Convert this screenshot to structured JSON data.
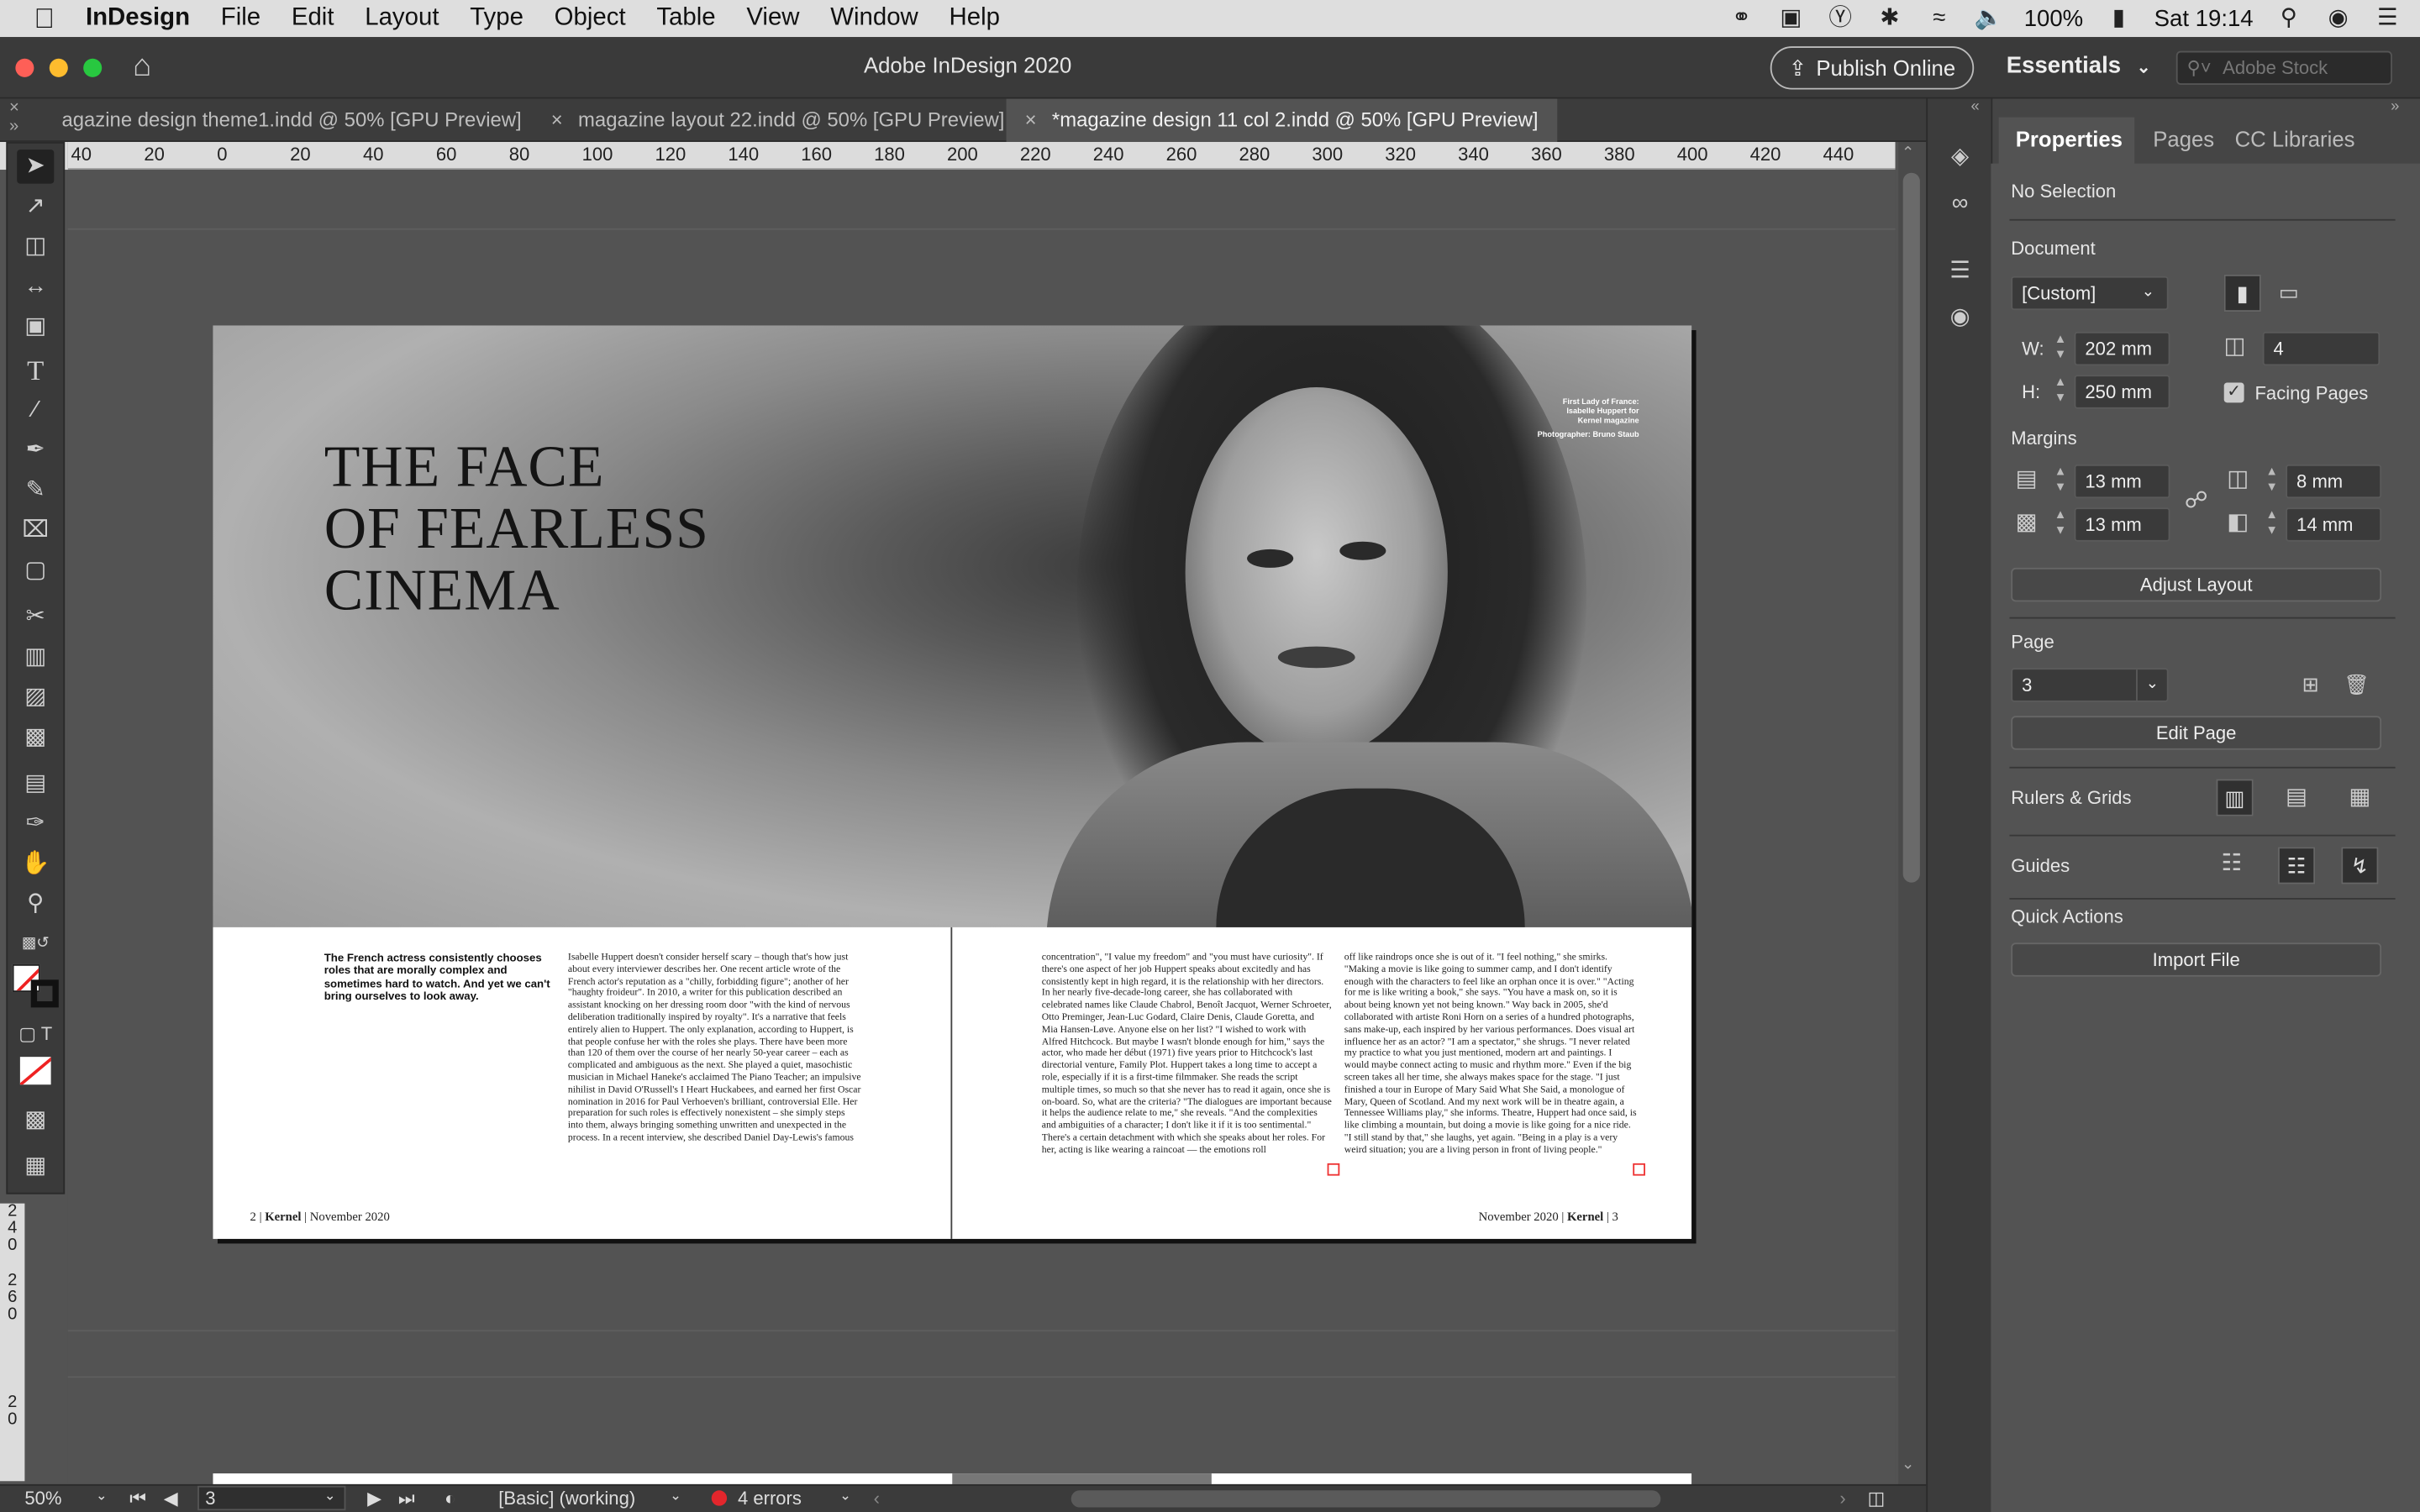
{
  "menubar": {
    "app": "InDesign",
    "items": [
      "File",
      "Edit",
      "Layout",
      "Type",
      "Object",
      "Table",
      "View",
      "Window",
      "Help"
    ],
    "battery": "100%",
    "clock": "Sat 19:14"
  },
  "window": {
    "title": "Adobe InDesign 2020",
    "publish_label": "Publish Online",
    "workspace": "Essentials",
    "stock_placeholder": "Adobe Stock"
  },
  "tabs": [
    {
      "label": "agazine design theme1.indd @ 50% [GPU Preview]",
      "active": false
    },
    {
      "label": "magazine layout 22.indd @ 50% [GPU Preview]",
      "active": false
    },
    {
      "label": "*magazine design 11 col 2.indd @ 50% [GPU Preview]",
      "active": true
    }
  ],
  "ruler_h": [
    "40",
    "20",
    "0",
    "20",
    "40",
    "60",
    "80",
    "100",
    "120",
    "140",
    "160",
    "180",
    "200",
    "220",
    "240",
    "260",
    "280",
    "300",
    "320",
    "340",
    "360",
    "380",
    "400",
    "420",
    "440"
  ],
  "ruler_v": [
    "2",
    "4",
    "0",
    "2",
    "6",
    "0",
    "2",
    "0"
  ],
  "spread": {
    "headline": [
      "THE FACE",
      "OF FEARLESS",
      "CINEMA"
    ],
    "photo_credit": [
      "First Lady of France:",
      "Isabelle Huppert for",
      "Kernel magazine",
      "Photographer: Bruno Staub"
    ],
    "intro": "The French actress consistently chooses roles that are morally complex and sometimes hard to watch. And yet we can't bring ourselves to look away.",
    "col1": "Isabelle Huppert doesn't consider herself scary – though that's how just about every interviewer describes her. One recent article wrote of the French actor's reputation as a \"chilly, forbidding figure\"; another of her \"haughty froideur\". In 2010, a writer for this publication described an assistant knocking on her dressing room door \"with the kind of nervous deliberation traditionally inspired by royalty\". It's a narrative that feels entirely alien to Huppert. The only explanation, according to Huppert, is that people confuse her with the roles she plays. There have been more than 120 of them over the course of her nearly 50-year career – each as complicated and ambiguous as the next. She played a quiet, masochistic musician in Michael Haneke's acclaimed The Piano Teacher; an impulsive nihilist in David O'Russell's I Heart Huckabees, and earned her first Oscar nomination in 2016 for Paul Verhoeven's brilliant, controversial Elle. Her preparation for such roles is effectively nonexistent – she simply steps into them, always bringing something unwritten and unexpected in the process. In a recent interview, she described Daniel Day-Lewis's famous",
    "col2": "concentration\", \"I value my freedom\" and \"you must have curiosity\". If there's one aspect of her job Huppert speaks about excitedly and has consistently kept in high regard, it is the relationship with her directors. In her nearly five-decade-long career, she has collaborated with celebrated names like Claude Chabrol, Benoît Jacquot, Werner Schroeter, Otto Preminger, Jean-Luc Godard, Claire Denis, Claude Goretta, and Mia Hansen-Løve. Anyone else on her list? \"I wished to work with Alfred Hitchcock. But maybe I wasn't blonde enough for him,\" says the actor, who made her début (1971) five years prior to Hitchcock's last directorial venture, Family Plot. Huppert takes a long time to accept a role, especially if it is a first-time filmmaker. She reads the script multiple times, so much so that she never has to read it again, once she is on-board. So, what are the criteria? \"The dialogues are important because it helps the audience relate to me,\" she reveals. \"And the complexities and ambiguities of a character; I don't like it if it is too sentimental.\" There's a certain detachment with which she speaks about her roles. For her, acting is like wearing a raincoat — the emotions roll",
    "col3": "off like raindrops once she is out of it. \"I feel nothing,\" she smirks. \"Making a movie is like going to summer camp, and I don't identify enough with the characters to feel like an orphan once it is over.\" \"Acting for me is like writing a book,\" she says. \"You have a mask on, so it is about being known yet not being known.\" Way back in 2005, she'd collaborated with artiste Roni Horn on a series of a hundred photographs, sans make-up, each inspired by her various performances. Does visual art influence her as an actor? \"I am a spectator,\" she shrugs. \"I never related my practice to what you just mentioned, modern art and paintings. I would maybe connect acting to music and rhythm more.\" Even if the big screen takes all her time, she always makes space for the stage. \"I just finished a tour in Europe of Mary Said What She Said, a monologue of Mary, Queen of Scotland. And my next work will be in theatre again, a Tennessee Williams play,\" she informs. Theatre, Huppert had once said, is like climbing a mountain, but doing a movie is like going for a nice ride. \"I still stand by that,\" she laughs, yet again. \"Being in a play is a very weird situation; you are a living person in front of living people.\"",
    "folio_left": {
      "num": "2",
      "mag": "Kernel",
      "date": "November 2020"
    },
    "folio_right": {
      "num": "3",
      "mag": "Kernel",
      "date": "November 2020"
    }
  },
  "status": {
    "zoom": "50%",
    "page": "3",
    "profile": "[Basic] (working)",
    "errors": "4 errors"
  },
  "properties": {
    "tabs": [
      "Properties",
      "Pages",
      "CC Libraries"
    ],
    "selection": "No Selection",
    "document_label": "Document",
    "preset": "[Custom]",
    "w_label": "W:",
    "h_label": "H:",
    "width": "202 mm",
    "height": "250 mm",
    "pages": "4",
    "facing_pages_label": "Facing Pages",
    "facing_pages": true,
    "margins_label": "Margins",
    "margin_top": "13 mm",
    "margin_bottom": "13 mm",
    "margin_inside": "8 mm",
    "margin_outside": "14 mm",
    "adjust_layout": "Adjust Layout",
    "page_label": "Page",
    "page_value": "3",
    "edit_page": "Edit Page",
    "rulers_grids": "Rulers & Grids",
    "guides": "Guides",
    "quick_actions": "Quick Actions",
    "import_file": "Import File"
  }
}
